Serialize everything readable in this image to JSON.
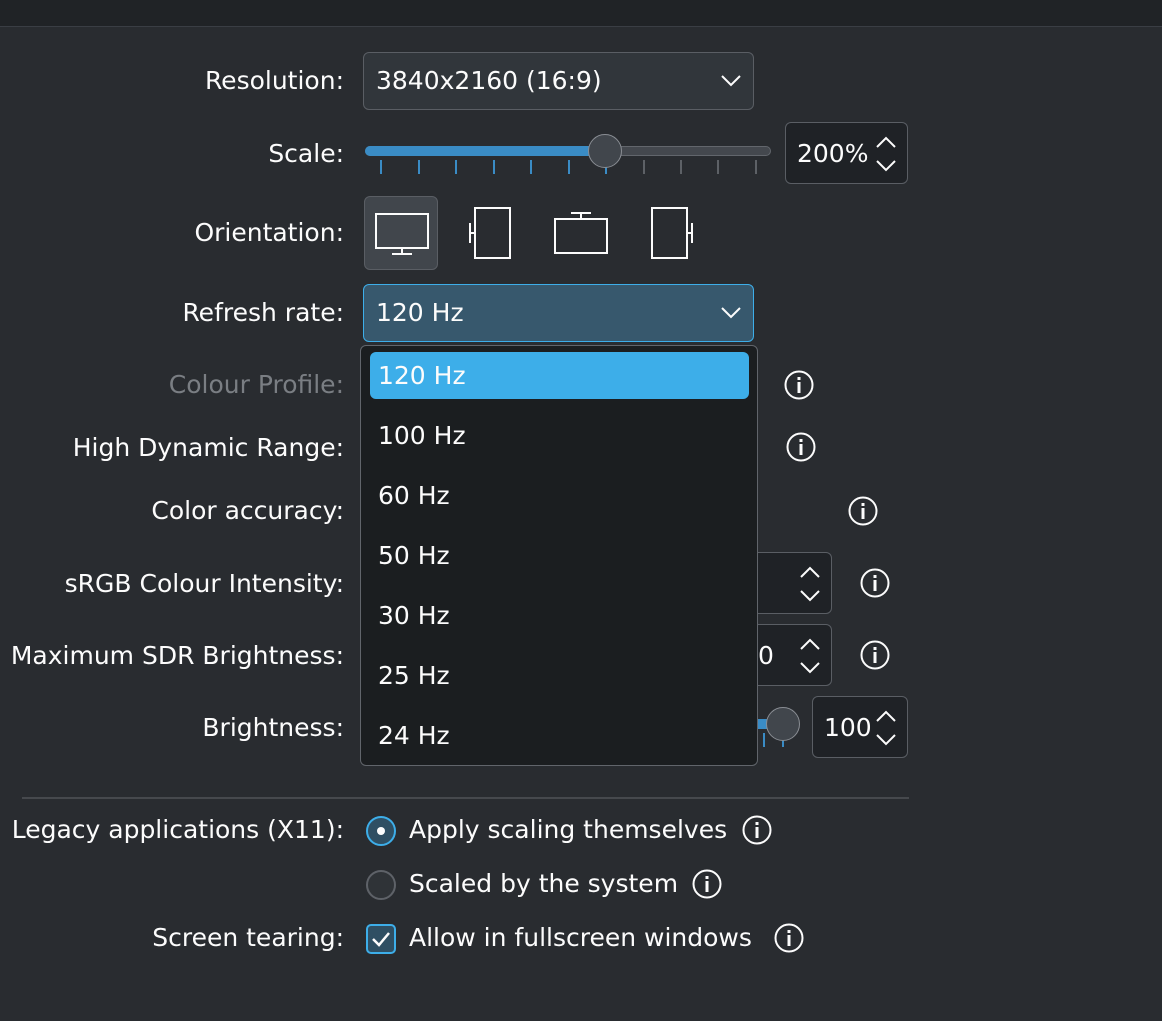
{
  "labels": {
    "resolution": "Resolution:",
    "scale": "Scale:",
    "orientation": "Orientation:",
    "refresh_rate": "Refresh rate:",
    "colour_profile": "Colour Profile:",
    "hdr": "High Dynamic Range:",
    "color_accuracy": "Color accuracy:",
    "srgb_intensity": "sRGB Colour Intensity:",
    "max_sdr_brightness": "Maximum SDR Brightness:",
    "brightness": "Brightness:",
    "legacy_apps": "Legacy applications (X11):",
    "screen_tearing": "Screen tearing:"
  },
  "resolution": {
    "value": "3840x2160 (16:9)"
  },
  "scale": {
    "value": "200%",
    "level_percent": 59
  },
  "refresh_rate": {
    "value": "120 Hz",
    "options": [
      "120 Hz",
      "100 Hz",
      "60 Hz",
      "50 Hz",
      "30 Hz",
      "25 Hz",
      "24 Hz"
    ],
    "selected_index": 0
  },
  "max_sdr_brightness": {
    "partial_value": "0"
  },
  "brightness": {
    "value": "100"
  },
  "legacy_apps": {
    "options": [
      {
        "label": "Apply scaling themselves",
        "selected": true
      },
      {
        "label": "Scaled by the system",
        "selected": false
      }
    ]
  },
  "screen_tearing": {
    "label": "Allow in fullscreen windows",
    "checked": true
  },
  "icons": {
    "chevron": "chevron-down-icon",
    "spin": "spin-arrows-icon",
    "info": "info-icon",
    "orientations": [
      "landscape-icon",
      "portrait-left-icon",
      "landscape-flipped-icon",
      "portrait-right-icon"
    ]
  },
  "colors": {
    "accent": "#3daee9",
    "background": "#292c30",
    "popup": "#1b1e20"
  }
}
